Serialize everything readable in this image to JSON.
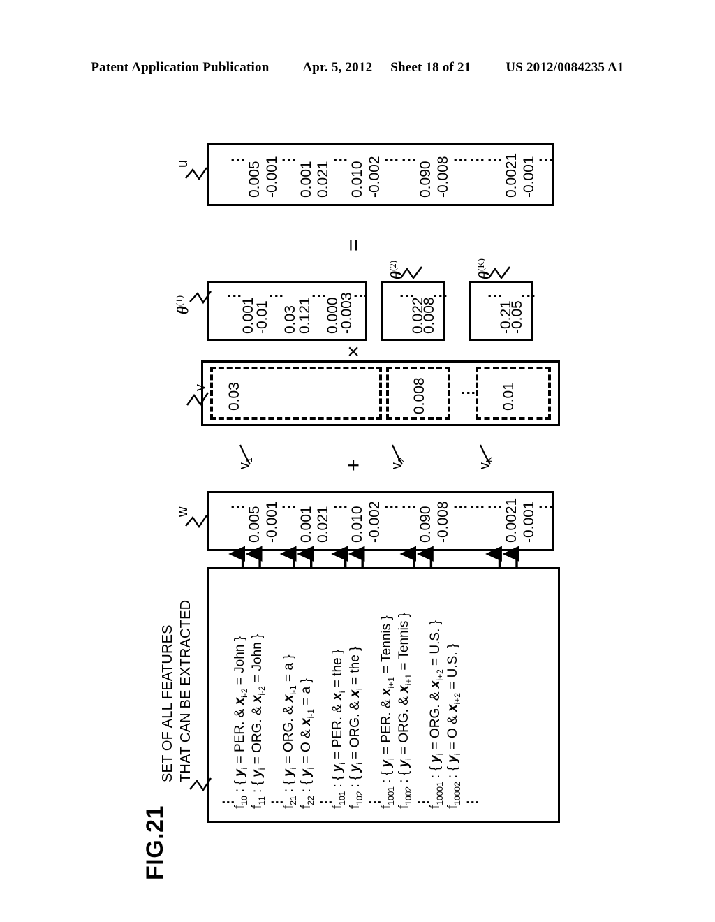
{
  "header": {
    "publication": "Patent Application Publication",
    "date": "Apr. 5, 2012",
    "sheet": "Sheet 18 of 21",
    "docnum": "US 2012/0084235 A1"
  },
  "figure": {
    "label": "FIG.21",
    "caption_line1": "SET OF ALL FEATURES",
    "caption_line2": "THAT CAN BE EXTRACTED",
    "operators": {
      "equals": "=",
      "times": "×",
      "plus": "+"
    }
  },
  "vector_u": {
    "label": "u",
    "cells": [
      "⋮",
      "0.005",
      "-0.001",
      "⋮",
      "0.001",
      "0.021",
      "⋮",
      "0.010",
      "-0.002",
      "⋮",
      "⋮",
      "0.090",
      "-0.008",
      "⋮",
      "⋮",
      "⋮",
      "0.0021",
      "-0.001",
      "⋮"
    ]
  },
  "vector_w": {
    "label": "w",
    "cells": [
      "⋮",
      "0.005",
      "-0.001",
      "⋮",
      "0.001",
      "0.021",
      "⋮",
      "0.010",
      "-0.002",
      "⋮",
      "⋮",
      "0.090",
      "-0.008",
      "⋮",
      "⋮",
      "⋮",
      "0.0021",
      "-0.001",
      "⋮"
    ]
  },
  "theta": [
    {
      "label": "θ",
      "sup": "(1)",
      "cells": [
        "⋮",
        "0.001",
        "-0.01",
        "⋮",
        "0.03",
        "0.121",
        "⋮",
        "0.000",
        "-0.003",
        "⋮"
      ]
    },
    {
      "label": "θ",
      "sup": "(2)",
      "cells": [
        "⋮",
        "0.022",
        "0.008",
        "⋮"
      ]
    },
    {
      "label": "θ",
      "sup": "(K)",
      "cells": [
        "⋮",
        "-0.21",
        "-0.05",
        "⋮"
      ]
    }
  ],
  "vector_v": {
    "label": "v",
    "segments": [
      {
        "label": "v",
        "sub": "1",
        "value": "0.03"
      },
      {
        "label": "v",
        "sub": "2",
        "value": "0.008"
      },
      {
        "label": "v",
        "sub": "K",
        "value": "0.01"
      }
    ],
    "separator_dots": "⋮"
  },
  "feature_set": {
    "groups": [
      {
        "lead_dots": "⋮",
        "rows": [
          {
            "id": "f",
            "sub": "10",
            "sep": ":",
            "body": "{ y_i = PER. & x_{i-2} = John }"
          },
          {
            "id": "f",
            "sub": "11",
            "sep": ":",
            "body": "{ y_i = ORG. & x_{i-2} = John }"
          }
        ]
      },
      {
        "lead_dots": "⋮",
        "rows": [
          {
            "id": "f",
            "sub": "21",
            "sep": ":",
            "body": "{ y_i = ORG. & x_{i-1} = a }"
          },
          {
            "id": "f",
            "sub": "22",
            "sep": ":",
            "body": "{ y_i = O & x_{i-1} = a }"
          }
        ]
      },
      {
        "lead_dots": "⋮",
        "rows": [
          {
            "id": "f",
            "sub": "101",
            "sep": ":",
            "body": "{ y_i = PER. & x_i = the }"
          },
          {
            "id": "f",
            "sub": "102",
            "sep": ":",
            "body": "{ y_i = ORG. & x_i = the }"
          }
        ]
      },
      {
        "lead_dots": "⋮",
        "rows": [
          {
            "id": "f",
            "sub": "1001",
            "sep": ":",
            "body": "{ y_i = PER. & x_{i+1} = Tennis }"
          },
          {
            "id": "f",
            "sub": "1002",
            "sep": ":",
            "body": "{ y_i = ORG. & x_{i+1} = Tennis }"
          }
        ]
      },
      {
        "lead_dots": "⋮",
        "rows": [
          {
            "id": "f",
            "sub": "10001",
            "sep": ":",
            "body": "{ y_i = ORG. & x_{i+2} = U.S. }"
          },
          {
            "id": "f",
            "sub": "10002",
            "sep": ":",
            "body": "{ y_i = O & x_{i+2} = U.S. }"
          }
        ]
      }
    ],
    "trailing_dots": "⋮"
  }
}
